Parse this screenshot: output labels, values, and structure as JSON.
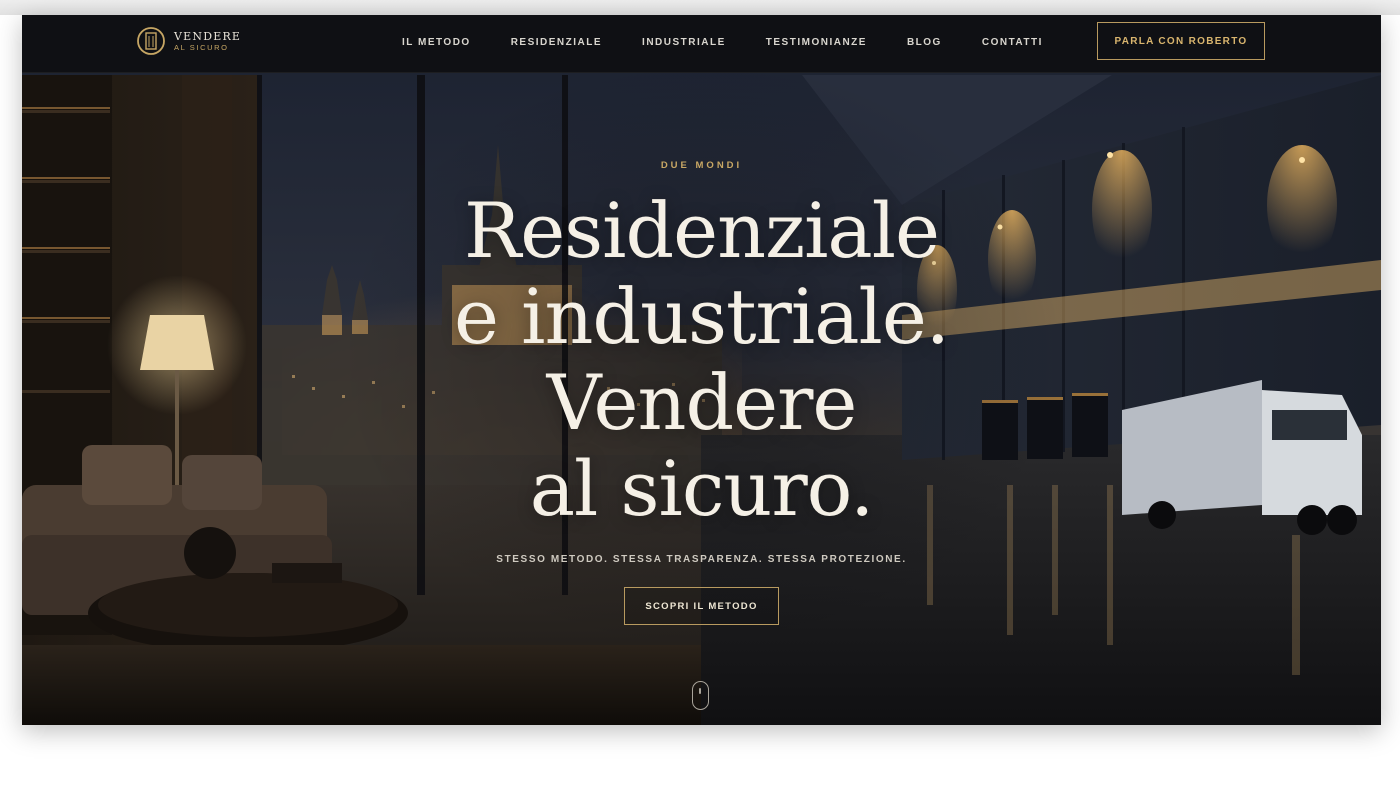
{
  "brand": {
    "name_line1": "VENDERE",
    "name_line2": "AL SICURO"
  },
  "nav": {
    "items": [
      {
        "label": "IL METODO"
      },
      {
        "label": "RESIDENZIALE"
      },
      {
        "label": "INDUSTRIALE"
      },
      {
        "label": "TESTIMONIANZE"
      },
      {
        "label": "BLOG"
      },
      {
        "label": "CONTATTI"
      }
    ],
    "cta_label": "PARLA CON ROBERTO"
  },
  "hero": {
    "eyebrow": "DUE MONDI",
    "headline_lines": [
      "Residenziale",
      "e industriale.",
      "Vendere",
      "al sicuro."
    ],
    "subline": "STESSO METODO. STESSA TRASPARENZA. STESSA PROTEZIONE.",
    "cta_label": "SCOPRI IL METODO"
  },
  "icons": {
    "logo": "building-in-circle-logo",
    "scroll": "mouse-scroll-icon"
  },
  "colors": {
    "accent_gold": "#c9a865",
    "headline": "#f5f0e6",
    "nav_bg": "#0e0e10"
  }
}
